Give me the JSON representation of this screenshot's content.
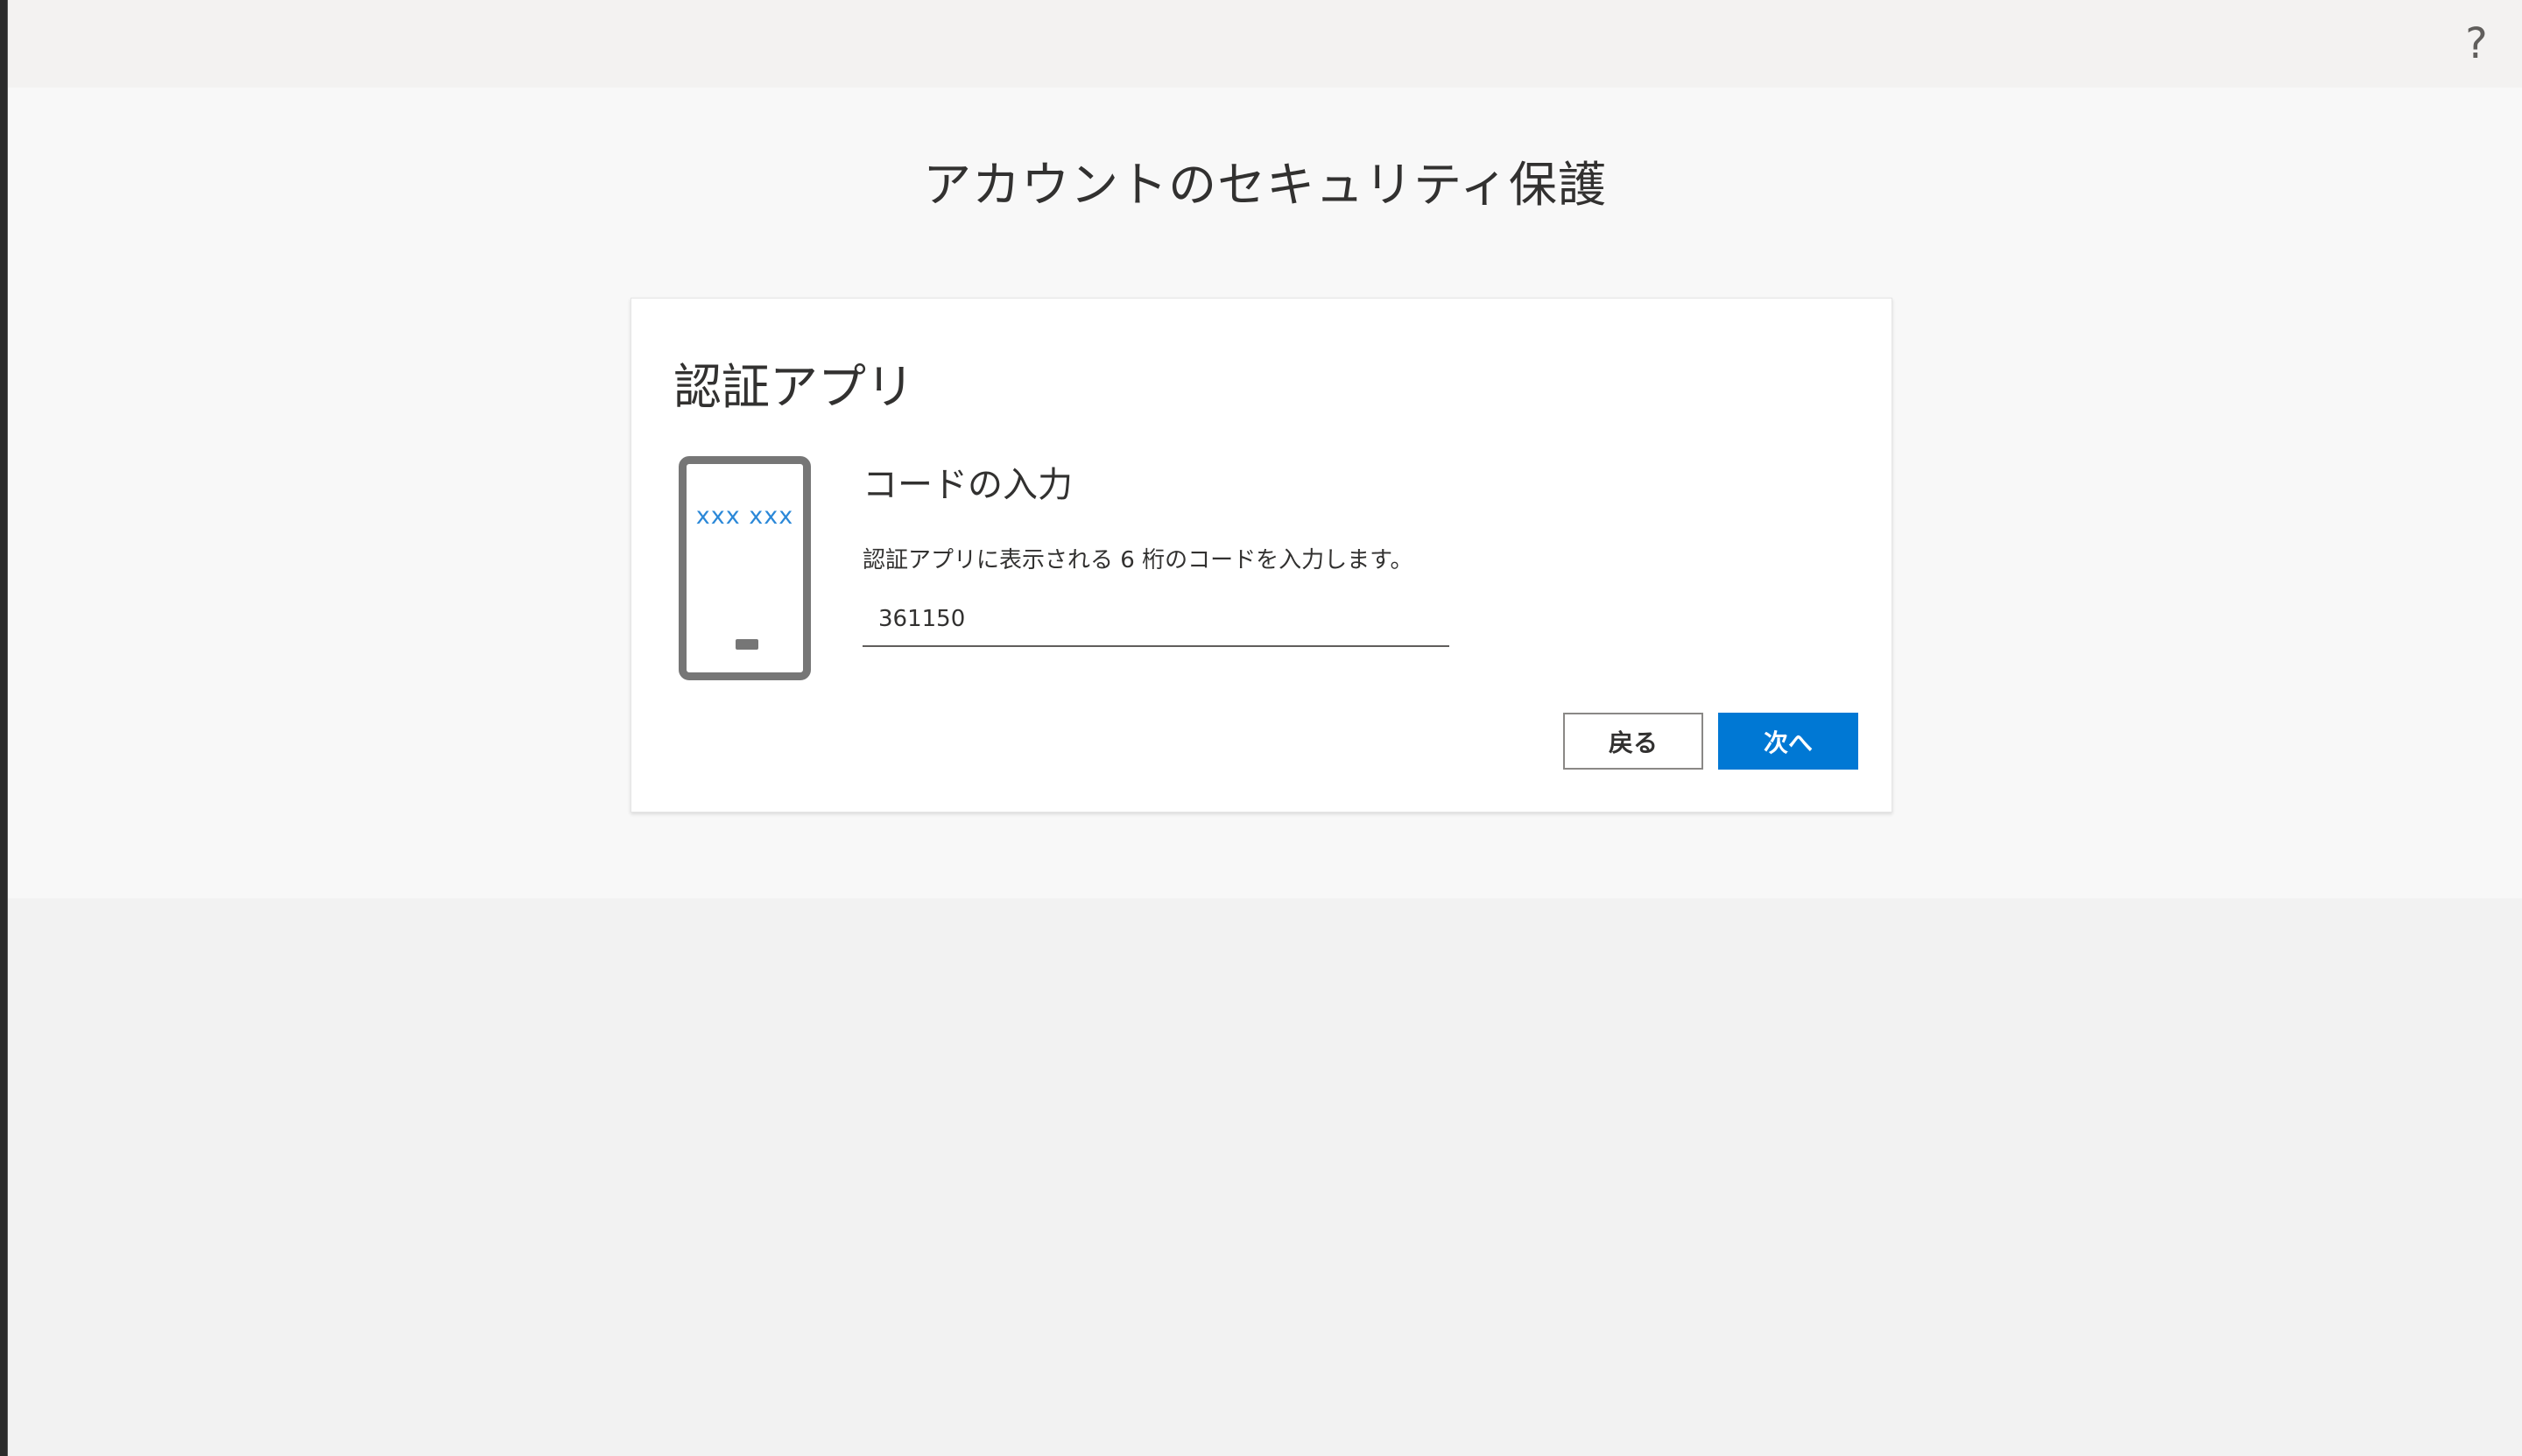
{
  "header": {
    "help_icon": "question-mark-icon",
    "help_glyph": "?"
  },
  "page": {
    "title": "アカウントのセキュリティ保護"
  },
  "card": {
    "title": "認証アプリ",
    "illustration": {
      "icon": "phone-icon",
      "code_placeholder": "xxx xxx"
    },
    "section_title": "コードの入力",
    "description": "認証アプリに表示される 6 桁のコードを入力します。",
    "code_input": {
      "value": "361150",
      "placeholder": ""
    },
    "buttons": {
      "back_label": "戻る",
      "next_label": "次へ"
    }
  },
  "colors": {
    "accent": "#0078d4",
    "code_text": "#2b88d8",
    "phone_frame": "#767676"
  }
}
